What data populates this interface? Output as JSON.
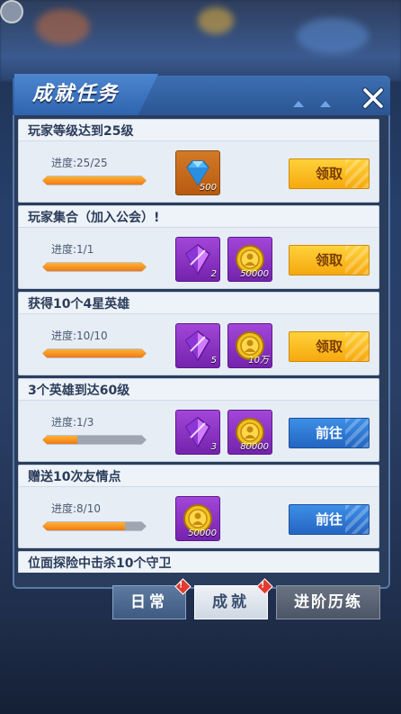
{
  "window": {
    "title": "成就任务"
  },
  "quests": [
    {
      "title": "玩家等级达到25级",
      "progress_text": "进度:25/25",
      "progress": 1.0,
      "rewards": [
        {
          "icon": "diamond-icon",
          "count": "500",
          "style": "orange"
        }
      ],
      "button": {
        "label": "领取",
        "type": "claim"
      }
    },
    {
      "title": "玩家集合（加入公会）!",
      "progress_text": "进度:1/1",
      "progress": 1.0,
      "rewards": [
        {
          "icon": "purple-crystal-icon",
          "count": "2",
          "style": "purple"
        },
        {
          "icon": "gold-coin-icon",
          "count": "50000",
          "style": "purple"
        }
      ],
      "button": {
        "label": "领取",
        "type": "claim"
      }
    },
    {
      "title": "获得10个4星英雄",
      "progress_text": "进度:10/10",
      "progress": 1.0,
      "rewards": [
        {
          "icon": "purple-crystal-icon",
          "count": "5",
          "style": "purple"
        },
        {
          "icon": "gold-coin-icon",
          "count": "10万",
          "style": "purple"
        }
      ],
      "button": {
        "label": "领取",
        "type": "claim"
      }
    },
    {
      "title": "3个英雄到达60级",
      "progress_text": "进度:1/3",
      "progress": 0.333,
      "rewards": [
        {
          "icon": "purple-crystal-icon",
          "count": "3",
          "style": "purple"
        },
        {
          "icon": "gold-coin-icon",
          "count": "80000",
          "style": "purple"
        }
      ],
      "button": {
        "label": "前往",
        "type": "go"
      }
    },
    {
      "title": "赠送10次友情点",
      "progress_text": "进度:8/10",
      "progress": 0.8,
      "rewards": [
        {
          "icon": "gold-coin-icon",
          "count": "50000",
          "style": "purple"
        }
      ],
      "button": {
        "label": "前往",
        "type": "go"
      }
    },
    {
      "title": "位面探险中击杀10个守卫"
    }
  ],
  "tabs": [
    {
      "label": "日常",
      "badge": "!"
    },
    {
      "label": "成就",
      "badge": "!"
    },
    {
      "label": "进阶历练"
    }
  ]
}
